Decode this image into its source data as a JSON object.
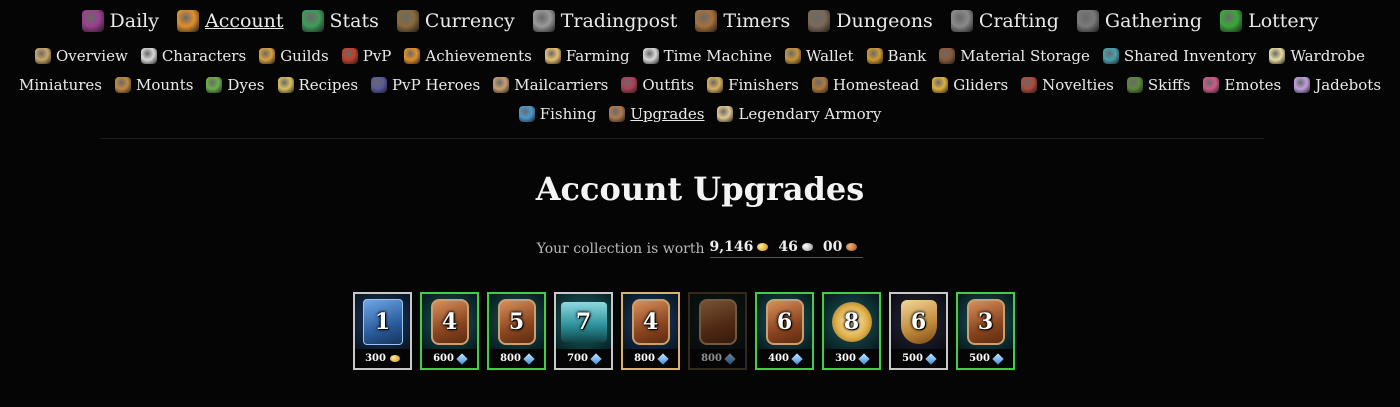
{
  "main_nav": [
    {
      "label": "Daily",
      "icon": "daily-icon",
      "color": "#9c3f8f",
      "active": false
    },
    {
      "label": "Account",
      "icon": "account-icon",
      "color": "#e0902a",
      "active": true
    },
    {
      "label": "Stats",
      "icon": "stats-icon",
      "color": "#3f9c5a",
      "active": false
    },
    {
      "label": "Currency",
      "icon": "currency-icon",
      "color": "#8a6a3a",
      "active": false
    },
    {
      "label": "Tradingpost",
      "icon": "tradingpost-icon",
      "color": "#9a9a9a",
      "active": false
    },
    {
      "label": "Timers",
      "icon": "timers-icon",
      "color": "#a8703a",
      "active": false
    },
    {
      "label": "Dungeons",
      "icon": "dungeons-icon",
      "color": "#7a6a58",
      "active": false
    },
    {
      "label": "Crafting",
      "icon": "crafting-icon",
      "color": "#8a8a8a",
      "active": false
    },
    {
      "label": "Gathering",
      "icon": "gathering-icon",
      "color": "#7a7a7a",
      "active": false
    },
    {
      "label": "Lottery",
      "icon": "lottery-icon",
      "color": "#3aa83a",
      "active": false
    }
  ],
  "sub_nav": {
    "row1": [
      {
        "label": "Overview",
        "icon": "overview-icon",
        "color": "#c9a86a"
      },
      {
        "label": "Characters",
        "icon": "characters-icon",
        "color": "#d9d9d9"
      },
      {
        "label": "Guilds",
        "icon": "guilds-icon",
        "color": "#d8a040"
      },
      {
        "label": "PvP",
        "icon": "pvp-icon",
        "color": "#c0402a"
      },
      {
        "label": "Achievements",
        "icon": "achievements-icon",
        "color": "#e0902a"
      },
      {
        "label": "Farming",
        "icon": "farming-icon",
        "color": "#e8c070"
      },
      {
        "label": "Time Machine",
        "icon": "time-machine-icon",
        "color": "#d8d8d8"
      },
      {
        "label": "Wallet",
        "icon": "wallet-icon",
        "color": "#c8963a"
      },
      {
        "label": "Bank",
        "icon": "bank-icon",
        "color": "#d09a30"
      },
      {
        "label": "Material Storage",
        "icon": "material-storage-icon",
        "color": "#8a5a3a"
      },
      {
        "label": "Shared Inventory",
        "icon": "shared-inventory-icon",
        "color": "#4aa0b0"
      },
      {
        "label": "Wardrobe",
        "icon": "wardrobe-icon",
        "color": "#e8dca0"
      }
    ],
    "row2": [
      {
        "label": "Miniatures",
        "icon": "",
        "color": ""
      },
      {
        "label": "Mounts",
        "icon": "mounts-icon",
        "color": "#c08a40"
      },
      {
        "label": "Dyes",
        "icon": "dyes-icon",
        "color": "#6ab04a"
      },
      {
        "label": "Recipes",
        "icon": "recipes-icon",
        "color": "#d8c060"
      },
      {
        "label": "PvP Heroes",
        "icon": "pvp-heroes-icon",
        "color": "#5a5aa0"
      },
      {
        "label": "Mailcarriers",
        "icon": "mailcarriers-icon",
        "color": "#c8a070"
      },
      {
        "label": "Outfits",
        "icon": "outfits-icon",
        "color": "#b0405a"
      },
      {
        "label": "Finishers",
        "icon": "finishers-icon",
        "color": "#d8b060"
      },
      {
        "label": "Homestead",
        "icon": "homestead-icon",
        "color": "#b07a3a"
      },
      {
        "label": "Gliders",
        "icon": "gliders-icon",
        "color": "#e0b040"
      },
      {
        "label": "Novelties",
        "icon": "novelties-icon",
        "color": "#b04a3a"
      },
      {
        "label": "Skiffs",
        "icon": "skiffs-icon",
        "color": "#5a8a3a"
      },
      {
        "label": "Emotes",
        "icon": "emotes-icon",
        "color": "#d05a8a"
      },
      {
        "label": "Jadebots",
        "icon": "jadebots-icon",
        "color": "#c0a0e0"
      }
    ],
    "row3": [
      {
        "label": "Fishing",
        "icon": "fishing-icon",
        "color": "#4a9ad0",
        "active": false
      },
      {
        "label": "Upgrades",
        "icon": "upgrades-icon",
        "color": "#b07a50",
        "active": true
      },
      {
        "label": "Legendary Armory",
        "icon": "legendary-armory-icon",
        "color": "#e0c890",
        "active": false
      }
    ]
  },
  "page": {
    "title": "Account Upgrades",
    "worth_label": "Your collection is worth",
    "worth_gold": "9,146",
    "worth_silver": "46",
    "worth_copper": "00"
  },
  "upgrades": [
    {
      "count": "1",
      "price": "300",
      "currency": "gold",
      "border": "silver",
      "art": "book",
      "bg": "bg-blue"
    },
    {
      "count": "4",
      "price": "600",
      "currency": "gem",
      "border": "green",
      "art": "plaque",
      "bg": "bg-teal"
    },
    {
      "count": "5",
      "price": "800",
      "currency": "gem",
      "border": "green",
      "art": "plaque",
      "bg": "bg-teal"
    },
    {
      "count": "7",
      "price": "700",
      "currency": "gem",
      "border": "silver",
      "art": "bag",
      "bg": "bg-cyan"
    },
    {
      "count": "4",
      "price": "800",
      "currency": "gem",
      "border": "gold",
      "art": "plaque",
      "bg": "bg-blue"
    },
    {
      "count": "",
      "price": "800",
      "currency": "gem",
      "border": "dim",
      "art": "plaque",
      "bg": "bg-dark"
    },
    {
      "count": "6",
      "price": "400",
      "currency": "gem",
      "border": "green",
      "art": "plaque",
      "bg": "bg-teal"
    },
    {
      "count": "8",
      "price": "300",
      "currency": "gem",
      "border": "green",
      "art": "wing",
      "bg": "bg-teal"
    },
    {
      "count": "6",
      "price": "500",
      "currency": "gem",
      "border": "silver",
      "art": "shield",
      "bg": "bg-violet"
    },
    {
      "count": "3",
      "price": "500",
      "currency": "gem",
      "border": "green",
      "art": "plaque",
      "bg": "bg-teal"
    }
  ]
}
